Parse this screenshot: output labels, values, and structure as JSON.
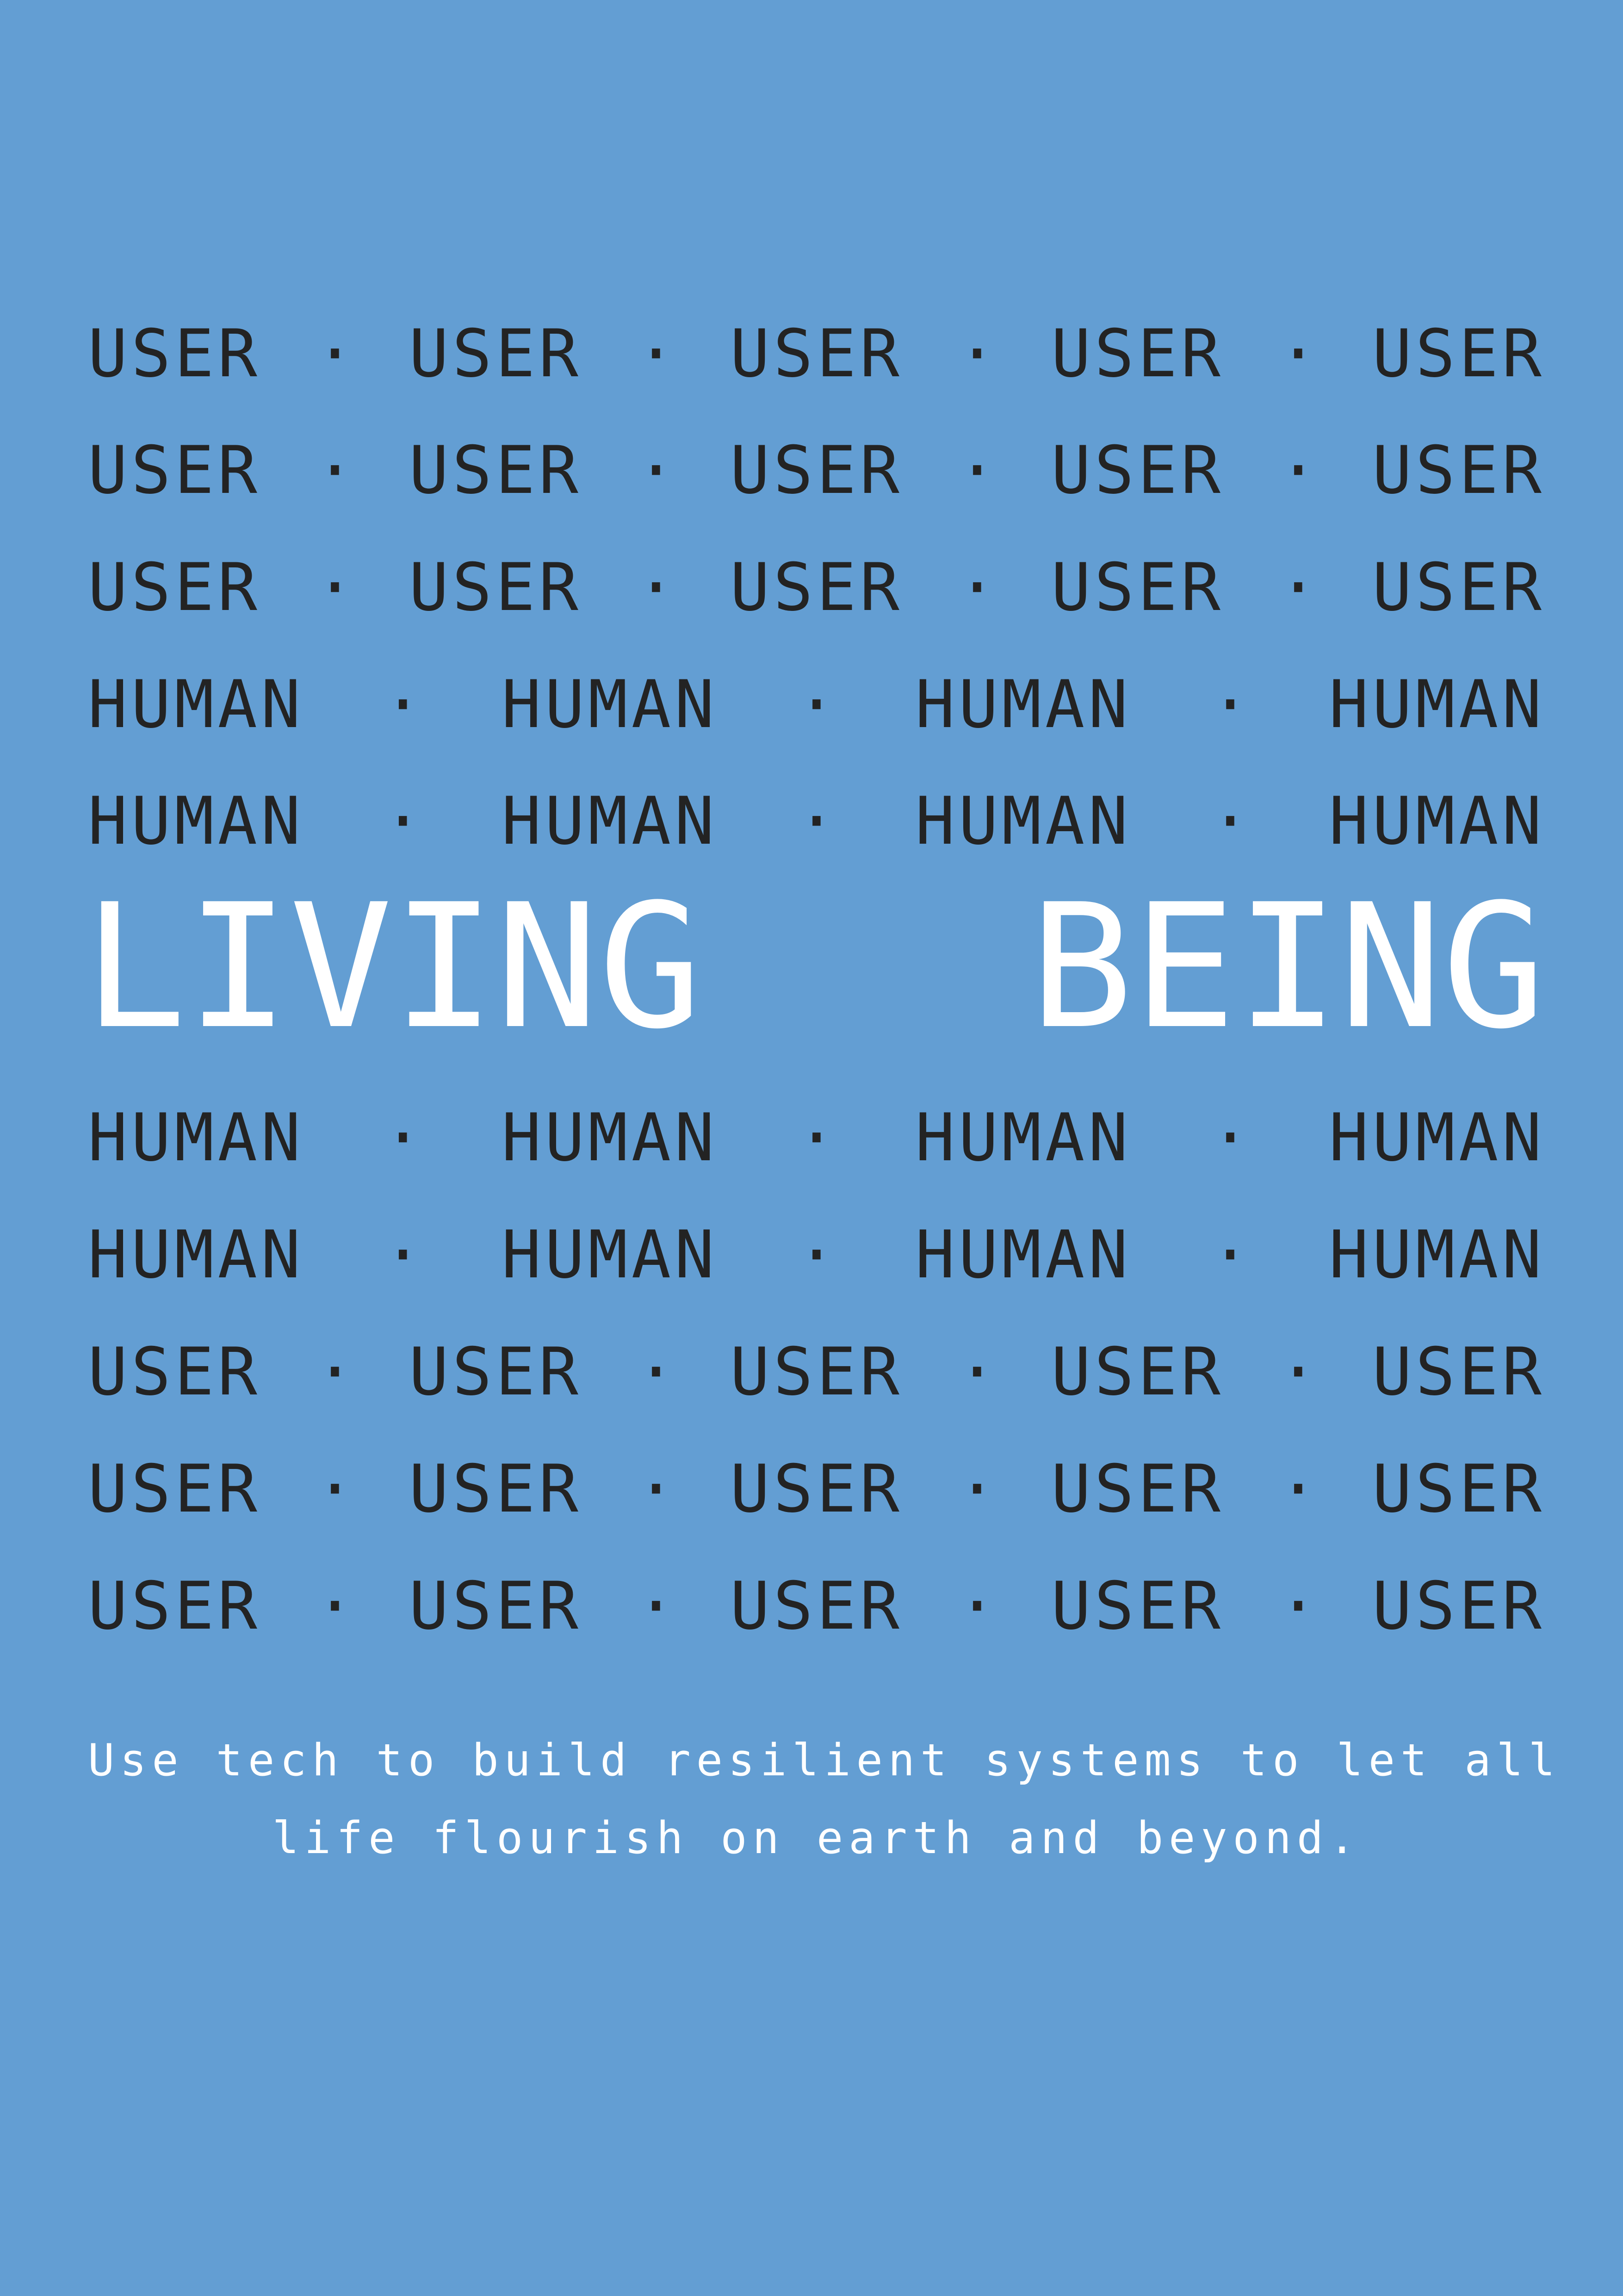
{
  "colors": {
    "background": "#639ed3",
    "word_text": "#232323",
    "headline_text": "#ffffff"
  },
  "separator": "·",
  "rows_top": [
    [
      "USER",
      "USER",
      "USER",
      "USER",
      "USER"
    ],
    [
      "USER",
      "USER",
      "USER",
      "USER",
      "USER"
    ],
    [
      "USER",
      "USER",
      "USER",
      "USER",
      "USER"
    ],
    [
      "HUMAN",
      "HUMAN",
      "HUMAN",
      "HUMAN"
    ],
    [
      "HUMAN",
      "HUMAN",
      "HUMAN",
      "HUMAN"
    ]
  ],
  "headline": {
    "word1": "LIVING",
    "word2": "BEING"
  },
  "rows_bottom": [
    [
      "HUMAN",
      "HUMAN",
      "HUMAN",
      "HUMAN"
    ],
    [
      "HUMAN",
      "HUMAN",
      "HUMAN",
      "HUMAN"
    ],
    [
      "USER",
      "USER",
      "USER",
      "USER",
      "USER"
    ],
    [
      "USER",
      "USER",
      "USER",
      "USER",
      "USER"
    ],
    [
      "USER",
      "USER",
      "USER",
      "USER",
      "USER"
    ]
  ],
  "tagline": {
    "line1": "Use tech to build resilient systems to let all",
    "line2": "life flourish on earth and beyond."
  }
}
